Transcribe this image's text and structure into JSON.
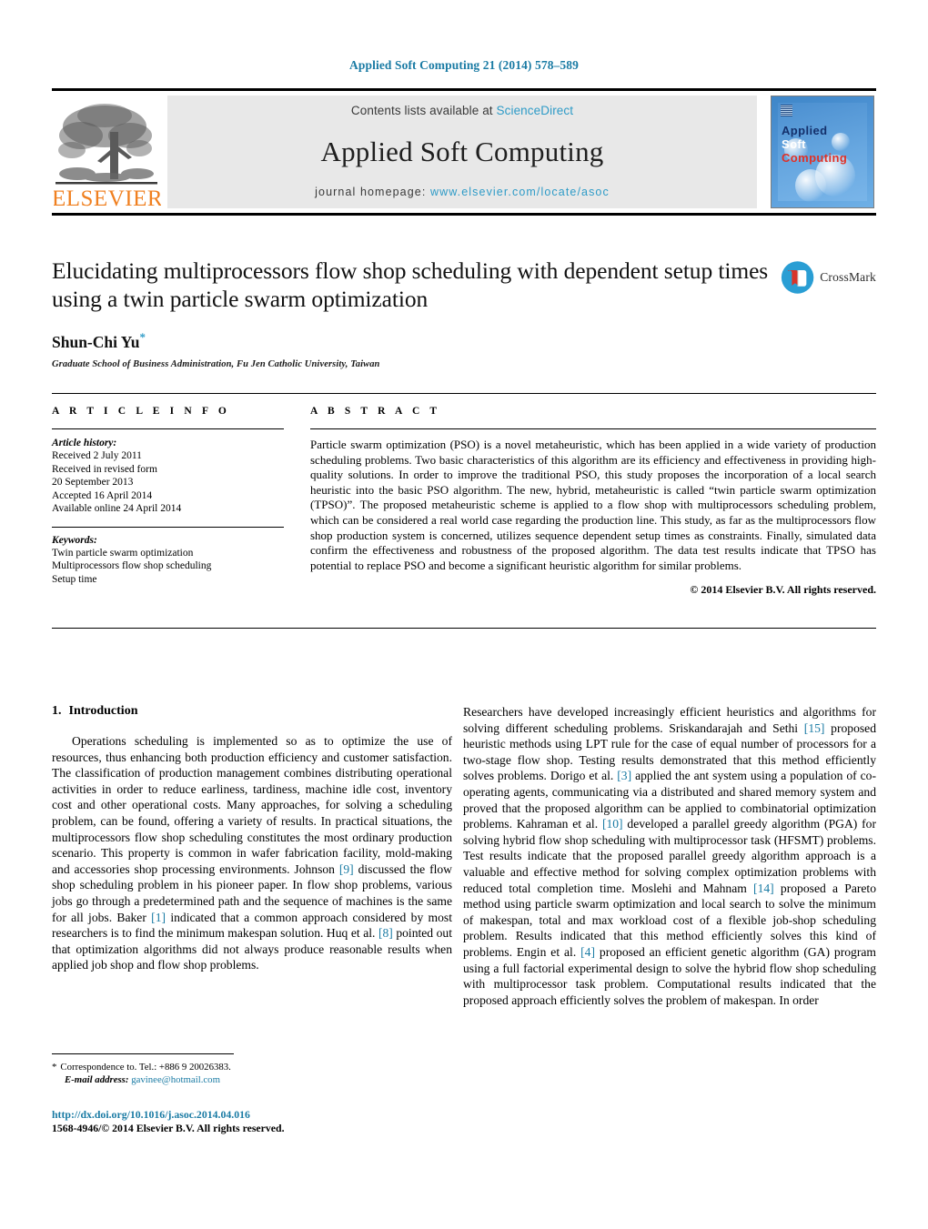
{
  "running_head": "Applied Soft Computing 21 (2014) 578–589",
  "masthead": {
    "contents_text": "Contents lists available at ",
    "sciencedirect": "ScienceDirect",
    "journal_name": "Applied Soft Computing",
    "homepage_label": "journal homepage:",
    "homepage_url": "www.elsevier.com/locate/asoc",
    "publisher_logo_text": "ELSEVIER",
    "cover": {
      "word1": "Applied",
      "word2": "Soft",
      "word3": "Computing"
    },
    "colors": {
      "link_blue": "#2e9bc7",
      "banner_gray": "#e8e8e8",
      "elsevier_orange": "#f08020",
      "cover_blue": "#4e93d4",
      "cover_red": "#e03127"
    }
  },
  "article": {
    "title": "Elucidating multiprocessors flow shop scheduling with dependent setup times using a twin particle swarm optimization",
    "author": "Shun-Chi Yu",
    "author_marker": "*",
    "affiliation": "Graduate School of Business Administration, Fu Jen Catholic University, Taiwan",
    "crossmark_label": "CrossMark"
  },
  "info": {
    "heading": "A R T I C L E    I N F O",
    "history_label": "Article history:",
    "history_lines": [
      "Received 2 July 2011",
      "Received in revised form",
      "20 September 2013",
      "Accepted 16 April 2014",
      "Available online 24 April 2014"
    ],
    "keywords_label": "Keywords:",
    "keywords": [
      "Twin particle swarm optimization",
      "Multiprocessors flow shop scheduling",
      "Setup time"
    ]
  },
  "abstract": {
    "heading": "A B S T R A C T",
    "body": "Particle swarm optimization (PSO) is a novel metaheuristic, which has been applied in a wide variety of production scheduling problems. Two basic characteristics of this algorithm are its efficiency and effectiveness in providing high-quality solutions. In order to improve the traditional PSO, this study proposes the incorporation of a local search heuristic into the basic PSO algorithm. The new, hybrid, metaheuristic is called “twin particle swarm optimization (TPSO)”. The proposed metaheuristic scheme is applied to a flow shop with multiprocessors scheduling problem, which can be considered a real world case regarding the production line. This study, as far as the multiprocessors flow shop production system is concerned, utilizes sequence dependent setup times as constraints. Finally, simulated data confirm the effectiveness and robustness of the proposed algorithm. The data test results indicate that TPSO has potential to replace PSO and become a significant heuristic algorithm for similar problems.",
    "copyright": "© 2014 Elsevier B.V. All rights reserved."
  },
  "introduction": {
    "number": "1.",
    "heading": "Introduction",
    "left_paragraph_1": "Operations scheduling is implemented so as to optimize the use of resources, thus enhancing both production efficiency and customer satisfaction. The classification of production management combines distributing operational activities in order to reduce earliness, tardiness, machine idle cost, inventory cost and other operational costs. Many approaches, for solving a scheduling problem, can be found, offering a variety of results. In practical situations, the multiprocessors flow shop scheduling constitutes the most ordinary production scenario. This property is common in wafer fabrication facility, mold-making and accessories shop processing environments. Johnson ",
    "left_ref_1": "[9]",
    "left_paragraph_2": " discussed the flow shop scheduling problem in his pioneer paper. In flow shop problems, various jobs go through a predetermined path and the sequence of machines is the same for all jobs. Baker ",
    "left_ref_2": "[1]",
    "left_paragraph_3": " indicated that a common approach considered by most researchers is to find the minimum makespan solution. Huq et al. ",
    "left_ref_3": "[8]",
    "left_paragraph_4": " pointed out that optimization algorithms did not always produce reasonable results when applied job shop and flow shop problems.",
    "right_paragraph_1": "Researchers have developed increasingly efficient heuristics and algorithms for solving different scheduling problems. Sriskandarajah and Sethi ",
    "right_ref_1": "[15]",
    "right_paragraph_2": " proposed heuristic methods using LPT rule for the case of equal number of processors for a two-stage flow shop. Testing results demonstrated that this method efficiently solves problems. Dorigo et al. ",
    "right_ref_2": "[3]",
    "right_paragraph_3": " applied the ant system using a population of co-operating agents, communicating via a distributed and shared memory system and proved that the proposed algorithm can be applied to combinatorial optimization problems. Kahraman et al. ",
    "right_ref_3": "[10]",
    "right_paragraph_4": " developed a parallel greedy algorithm (PGA) for solving hybrid flow shop scheduling with multiprocessor task (HFSMT) problems. Test results indicate that the proposed parallel greedy algorithm approach is a valuable and effective method for solving complex optimization problems with reduced total completion time. Moslehi and Mahnam ",
    "right_ref_4": "[14]",
    "right_paragraph_5": " proposed a Pareto method using particle swarm optimization and local search to solve the minimum of makespan, total and max workload cost of a flexible job-shop scheduling problem. Results indicated that this method efficiently solves this kind of problems. Engin et al. ",
    "right_ref_5": "[4]",
    "right_paragraph_6": " proposed an efficient genetic algorithm (GA) program using a full factorial experimental design to solve the hybrid flow shop scheduling with multiprocessor task problem. Computational results indicated that the proposed approach efficiently solves the problem of makespan. In order"
  },
  "footer": {
    "correspondence_marker": "*",
    "correspondence_text": "Correspondence to. Tel.: +886 9 20026383.",
    "email_label": "E-mail address:",
    "email": "gavinee@hotmail.com",
    "doi": "http://dx.doi.org/10.1016/j.asoc.2014.04.016",
    "issn_line": "1568-4946/© 2014 Elsevier B.V. All rights reserved."
  }
}
